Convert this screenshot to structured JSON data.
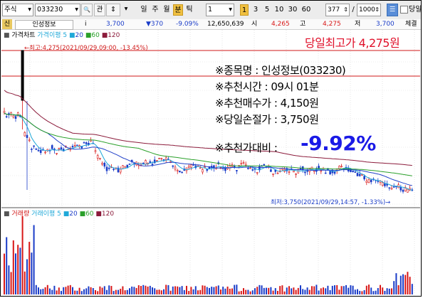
{
  "toolbar": {
    "market": "주식",
    "code": "033230",
    "search_btn": "🔍",
    "btn_gwan": "관",
    "stepper": "⇕",
    "period_day": "일",
    "period_week": "주",
    "period_month": "월",
    "period_min": "분",
    "period_tick": "틱",
    "unit_value": "1",
    "intervals": [
      "3",
      "5",
      "10",
      "30",
      "60"
    ],
    "count_value": "377",
    "max_value": "1000",
    "chk_label": "당일"
  },
  "quote": {
    "name": "인성정보",
    "info_icon": "i",
    "price": "3,700",
    "change": "▼370",
    "change_pct": "-9.09%",
    "volume": "12,650,639",
    "high_label": "시",
    "open_price": "4,265",
    "high_label2": "고",
    "high_price": "4,275",
    "low_label": "저",
    "low_price": "3,700",
    "end_label": "체결"
  },
  "price_legend": {
    "title": "가격차트",
    "ma_label": "가격이평",
    "periods": [
      "5",
      "20",
      "60",
      "120"
    ]
  },
  "volume_legend": {
    "title": "거래량",
    "ma_label": "거래이평",
    "periods": [
      "5",
      "20",
      "60",
      "120"
    ]
  },
  "annotations": {
    "high_marker": "←최고:4,275(2021/09/29,09:00, -13.45%)",
    "low_marker": "최저:3,750(2021/09/29,14:57, -1.33%)→",
    "headline": "당일최고가 4,275원",
    "stock_line": "※종목명 : 인성정보(033230)",
    "time_line": "※추천시간 : 09시 01분",
    "buy_line": "※추천매수가 : 4,150원",
    "stop_line": "※당일손절가 : 3,750원",
    "ratio_label": "※추천가대비 :",
    "ratio_value": "-9.92%"
  },
  "colors": {
    "up": "#d81818",
    "down": "#1a3cc8",
    "ma5": "#1fa8d8",
    "ma20": "#2040c8",
    "ma60": "#2aa02a",
    "ma120": "#8b1a3a",
    "headline": "#e0102a",
    "ratio": "#1a1ae6"
  },
  "chart_data": {
    "type": "candlestick",
    "title": "인성정보(033230) 1분봉",
    "high": 4275,
    "low": 3750,
    "last": 3700
  }
}
